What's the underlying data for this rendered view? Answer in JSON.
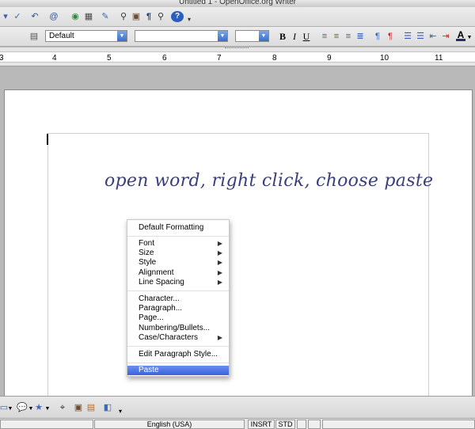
{
  "window": {
    "title": "Untitled 1 - OpenOffice.org Writer"
  },
  "formatting": {
    "style_value": "Default",
    "font_value": "",
    "size_value": "",
    "bold": "B",
    "italic": "I",
    "underline": "U",
    "font_color": "A"
  },
  "ruler": {
    "numbers": [
      "3",
      "4",
      "5",
      "6",
      "7",
      "8",
      "9",
      "10",
      "11"
    ]
  },
  "document": {
    "text": "open word, right click, choose paste"
  },
  "context_menu": {
    "items": [
      {
        "label": "Default Formatting"
      },
      {
        "label": "Font"
      },
      {
        "label": "Size"
      },
      {
        "label": "Style"
      },
      {
        "label": "Alignment"
      },
      {
        "label": "Line Spacing"
      },
      {
        "label": "Character..."
      },
      {
        "label": "Paragraph..."
      },
      {
        "label": "Page..."
      },
      {
        "label": "Numbering/Bullets..."
      },
      {
        "label": "Case/Characters"
      },
      {
        "label": "Edit Paragraph Style..."
      },
      {
        "label": "Paste"
      }
    ]
  },
  "statusbar": {
    "language": "English (USA)",
    "insert_mode": "INSRT",
    "selection_mode": "STD"
  },
  "colors": {
    "menu_highlight": "#3a62dc",
    "handwritten_text": "#3a3f7a"
  }
}
